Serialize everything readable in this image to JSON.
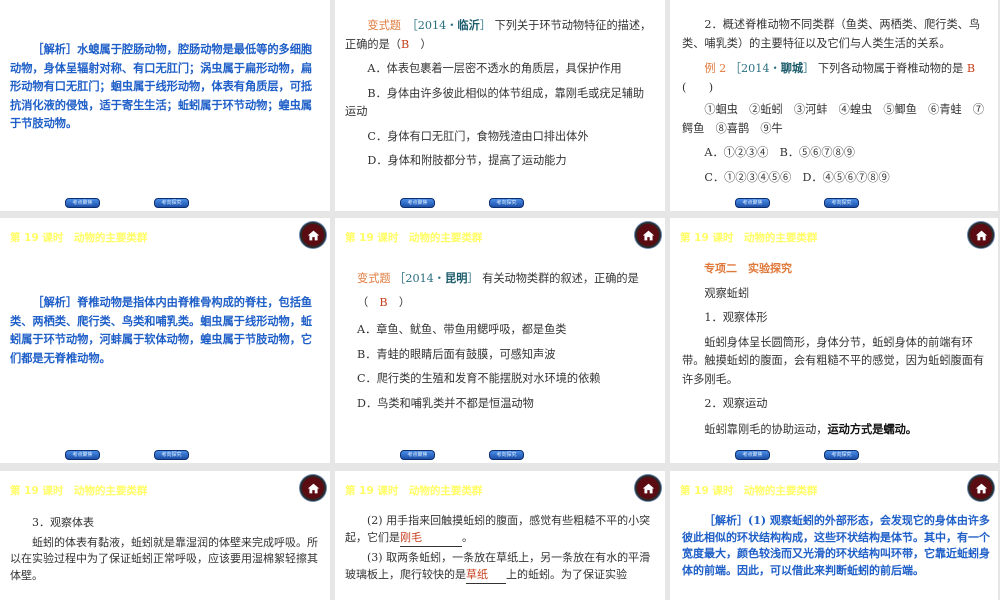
{
  "header": "第 19 课时　动物的主要类群",
  "nav": {
    "prev": "考点聚焦",
    "next": "考向探究"
  },
  "slide1": {
    "tag": "［解析］",
    "text": "水螅属于腔肠动物，腔肠动物是最低等的多细胞动物，身体呈辐射对称、有口无肛门；涡虫属于扁形动物，扁形动物有口无肛门；蛔虫属于线形动物，体表有角质层，可抵抗消化液的侵蚀，适于寄生生活；蚯蚓属于环节动物；蝗虫属于节肢动物。"
  },
  "slide2": {
    "label": "变式题",
    "source_open": "［2014・",
    "source_city": "临沂",
    "source_close": "］",
    "question": "下列关于环节动物特征的描述，正确的是（",
    "answer": "B",
    "question_end": "　）",
    "options": [
      "A．体表包裹着一层密不透水的角质层，具保护作用",
      "B．身体由许多彼此相似的体节组成，靠刚毛或疣足辅助运动",
      "C．身体有口无肛门，食物残渣由口排出体外",
      "D．身体和附肢都分节，提高了运动能力"
    ]
  },
  "slide3": {
    "intro": "2．概述脊椎动物不同类群（鱼类、两栖类、爬行类、鸟类、哺乳类）的主要特征以及它们与人类生活的关系。",
    "label": "例 2",
    "source_open": "［2014・",
    "source_city": "聊城",
    "source_close": "］",
    "question": "下列各动物属于脊椎动物的是",
    "answer": "B",
    "paren": "(　　)",
    "items": "①蛔虫　②蚯蚓　③河蚌　④蝗虫　⑤鲫鱼　⑥青蛙　⑦鳄鱼　⑧喜鹊　⑨牛",
    "options_row1": "A．①②③④　B．⑤⑥⑦⑧⑨",
    "options_row2": "C．①②③④⑤⑥　D．④⑤⑥⑦⑧⑨"
  },
  "slide4": {
    "tag": "［解析］",
    "text": "脊椎动物是指体内由脊椎骨构成的脊柱，包括鱼类、两栖类、爬行类、鸟类和哺乳类。蛔虫属于线形动物，蚯蚓属于环节动物，河蚌属于软体动物，蝗虫属于节肢动物，它们都是无脊椎动物。"
  },
  "slide5": {
    "label": "变式题",
    "source_open": "［2014・",
    "source_city": "昆明",
    "source_close": "］",
    "question": "有关动物类群的叙述，正确的是",
    "paren_open": "（　",
    "answer": "B",
    "paren_close": "　）",
    "options": [
      "A．章鱼、鱿鱼、带鱼用鳃呼吸，都是鱼类",
      "B．青蛙的眼睛后面有鼓膜，可感知声波",
      "C．爬行类的生殖和发育不能摆脱对水环境的依赖",
      "D．鸟类和哺乳类并不都是恒温动物"
    ]
  },
  "slide6": {
    "section": "专项二　实验探究",
    "title": "观察蚯蚓",
    "step1": "1．观察体形",
    "step1_text": "蚯蚓身体呈长圆筒形，身体分节，蚯蚓身体的前端有环带。触摸蚯蚓的腹面，会有粗糙不平的感觉，因为蚯蚓腹面有许多刚毛。",
    "step2": "2．观察运动",
    "step2_text": "蚯蚓靠刚毛的协助运动，",
    "step2_bold": "运动方式是蠕动。"
  },
  "slide7": {
    "step3": "3．观察体表",
    "step3_text": "蚯蚓的体表有黏液，蚯蚓就是靠湿润的体壁来完成呼吸。所以在实验过程中为了保证蚯蚓正常呼吸，应该要用湿棉絮轻擦其体壁。"
  },
  "slide8": {
    "q2_text": "(2) 用手指来回触摸蚯蚓的腹面，感觉有些粗糙不平的小突起，它们是",
    "q2_answer": "刚毛",
    "q2_end": "。",
    "q3_text": "(3) 取两条蚯蚓，一条放在草纸上，另一条放在有水的平滑玻璃板上，爬行较快的是",
    "q3_answer": "草纸",
    "q3_end": "上的蚯蚓。为了保证实验"
  },
  "slide9": {
    "tag": "［解析］",
    "text": "(1) 观察蚯蚓的外部形态，会发现它的身体由许多彼此相似的环状结构构成，这些环状结构是体节。其中，有一个宽度最大，颜色较浅而又光滑的环状结构叫环带，它靠近蚯蚓身体的前端。因此，可以借此来判断蚯蚓的前后端。"
  }
}
